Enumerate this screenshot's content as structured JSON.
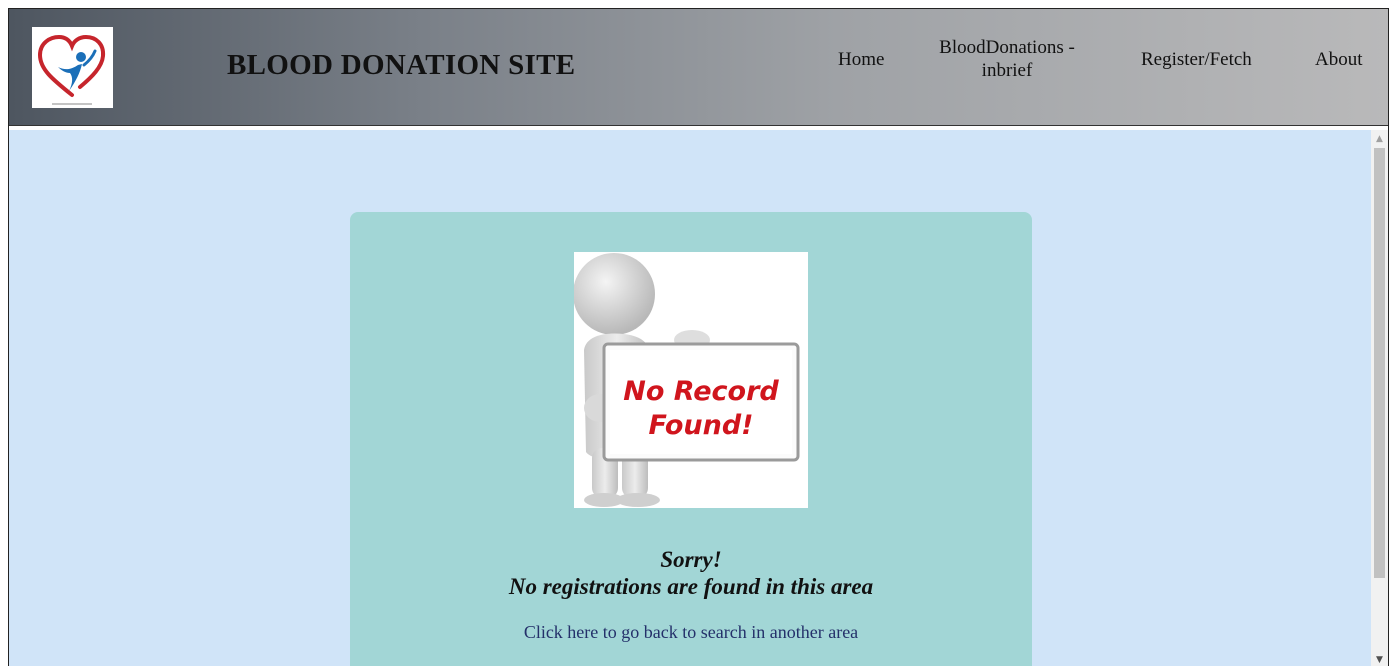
{
  "header": {
    "site_title": "BLOOD DONATION SITE",
    "logo_icon": "heart-person-logo"
  },
  "nav": {
    "home": "Home",
    "brief_line1": "BloodDonations -",
    "brief_line2": "inbrief",
    "register": "Register/Fetch",
    "about": "About"
  },
  "main": {
    "image_text_line1": "No Record",
    "image_text_line2": "Found!",
    "sorry": "Sorry!",
    "message": "No registrations are found in this area",
    "back_link": "Click here to go back to search in another area"
  },
  "colors": {
    "content_bg": "#d0e4f8",
    "card_bg": "#a2d6d6",
    "link": "#24306a",
    "image_text": "#d0151d"
  }
}
